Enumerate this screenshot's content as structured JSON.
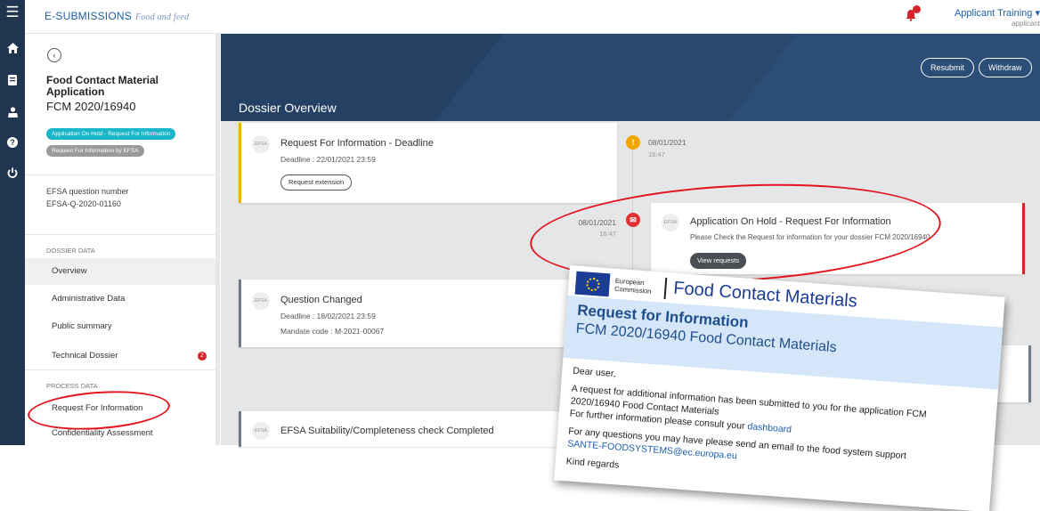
{
  "rail": {
    "icons": [
      "menu-icon",
      "home-icon",
      "document-icon",
      "user-icon",
      "help-icon",
      "power-icon"
    ]
  },
  "header": {
    "brand": "E-SUBMISSIONS",
    "brand_sub": "Food and feed",
    "notification_count": "1",
    "user_name": "Applicant Training ▾",
    "user_role": "applicant",
    "language": "EN"
  },
  "sidebar": {
    "app_title": "Food Contact Material Application",
    "app_number": "FCM 2020/16940",
    "status_badge_1": "Application On Hold - Request For Information",
    "status_badge_2": "Request For Information by EFSA",
    "question_label": "EFSA question number",
    "question_value": "EFSA-Q-2020-01160",
    "dossier_data_heading": "DOSSIER DATA",
    "process_data_heading": "PROCESS DATA",
    "dossier_items": [
      "Overview",
      "Administrative Data",
      "Public summary",
      "Technical Dossier"
    ],
    "technical_dossier_badge": "2",
    "process_items": [
      "Request For Information",
      "Confidentiality Assessment"
    ]
  },
  "main": {
    "title": "Dossier Overview",
    "resubmit_label": "Resubmit",
    "withdraw_label": "Withdraw",
    "efsa_label": "EFSA",
    "card1": {
      "title": "Request For Information - Deadline",
      "deadline": "Deadline : 22/01/2021 23:59",
      "button": "Request extension"
    },
    "event1": {
      "date": "08/01/2021",
      "time": "16:47",
      "icon": "!"
    },
    "card2": {
      "title": "Application On Hold - Request For Information",
      "text": "Please Check the Request for information for your dossier FCM 2020/16940",
      "button": "View requests"
    },
    "event2": {
      "date": "08/01/2021",
      "time": "16:47",
      "icon": "✉"
    },
    "card3": {
      "title": "Question Changed",
      "deadline": "Deadline : 18/02/2021 23:59",
      "mandate": "Mandate code : M-2021-00067"
    },
    "partial_date": "0",
    "card4": {
      "title": "EFSA Suitability/Completeness check Completed"
    }
  },
  "email": {
    "ec_line1": "European",
    "ec_line2": "Commission",
    "header_title": "Food Contact Materials",
    "h1": "Request for Information",
    "h2": "FCM 2020/16940 Food Contact Materials",
    "greeting": "Dear user,",
    "body_line1": "A request for additional information has been submitted to you for the application FCM",
    "body_line2": "2020/16940 Food Contact Materials",
    "body_line3_pre": "For further information please consult your ",
    "body_line3_link": "dashboard",
    "body_line4": "For any questions you may have please send an email to the food system support",
    "support_email": "SANTE-FOODSYSTEMS@ec.europa.eu",
    "closing": "Kind regards"
  },
  "colors": {
    "rail": "#1f3550",
    "hero": "#244062",
    "cyan_badge": "#19b5c9",
    "alert_orange": "#f0a500",
    "alert_red": "#d9232a",
    "annotation_red": "#e3141d",
    "email_blue": "#1f4e8c"
  }
}
